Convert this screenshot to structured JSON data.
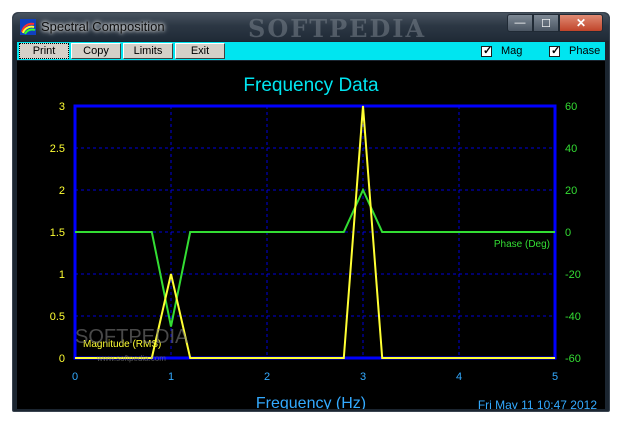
{
  "window": {
    "title": "Spectral Composition",
    "watermark": "SOFTPEDIA",
    "controls": {
      "minimize": "—",
      "maximize": "☐",
      "close": "✕"
    }
  },
  "toolbar": {
    "buttons": [
      "Print",
      "Copy",
      "Limits",
      "Exit"
    ],
    "checkboxes": [
      {
        "label": "Mag",
        "checked": true
      },
      {
        "label": "Phase",
        "checked": true
      }
    ]
  },
  "colors": {
    "magnitude": "#ffff33",
    "phase": "#33dd33",
    "axes": "#0000ff",
    "grid": "#0000dd",
    "title": "#00e5f0",
    "xticks": "#33aaff",
    "yticks": "#ffff33",
    "y2ticks": "#33dd33"
  },
  "plot": {
    "date": "Fri May 11 10:47 2012",
    "watermark": "SOFTPEDIA",
    "watermark_url": "www.softpedia.com"
  },
  "chart_data": {
    "type": "line",
    "title": "Frequency Data",
    "xlabel": "Frequency (Hz)",
    "xlim": [
      0,
      5
    ],
    "ylim": [
      0,
      3
    ],
    "y2lim": [
      -60,
      60
    ],
    "xticks": [
      "0",
      "1",
      "2",
      "3",
      "4",
      "5"
    ],
    "yticks": [
      "0",
      "0.5",
      "1",
      "1.5",
      "2",
      "2.5",
      "3"
    ],
    "y2ticks": [
      "-60",
      "-40",
      "-20",
      "0",
      "20",
      "40",
      "60"
    ],
    "grid": true,
    "series": [
      {
        "name": "Magnitude (RMS)",
        "axis": "left",
        "points": [
          [
            0,
            0
          ],
          [
            0.8,
            0
          ],
          [
            1.0,
            1.0
          ],
          [
            1.2,
            0
          ],
          [
            2.8,
            0
          ],
          [
            3.0,
            3.0
          ],
          [
            3.2,
            0
          ],
          [
            5,
            0
          ]
        ]
      },
      {
        "name": "Phase (Deg)",
        "axis": "right",
        "points": [
          [
            0,
            0
          ],
          [
            0.8,
            0
          ],
          [
            1.0,
            -45
          ],
          [
            1.2,
            0
          ],
          [
            2.8,
            0
          ],
          [
            3.0,
            20
          ],
          [
            3.2,
            0
          ],
          [
            5,
            0
          ]
        ]
      }
    ]
  }
}
